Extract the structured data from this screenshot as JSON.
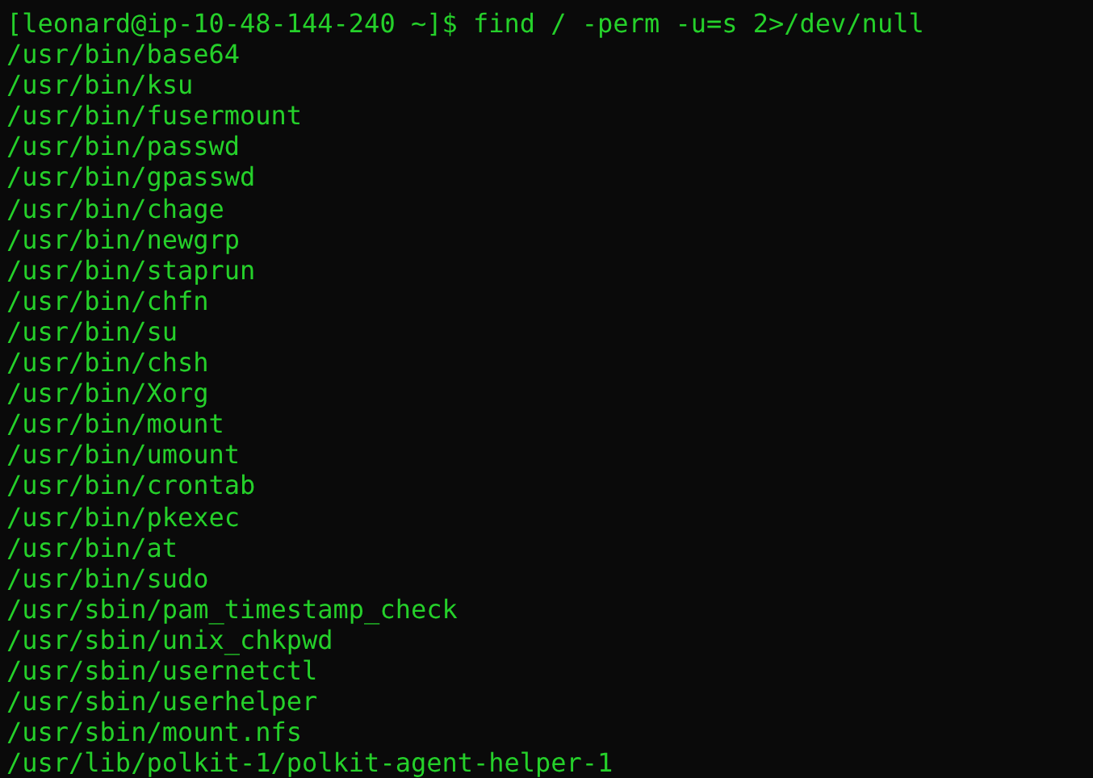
{
  "terminal": {
    "prompt": "[leonard@ip-10-48-144-240 ~]$ find / -perm -u=s 2>/dev/null",
    "output": [
      "/usr/bin/base64",
      "/usr/bin/ksu",
      "/usr/bin/fusermount",
      "/usr/bin/passwd",
      "/usr/bin/gpasswd",
      "/usr/bin/chage",
      "/usr/bin/newgrp",
      "/usr/bin/staprun",
      "/usr/bin/chfn",
      "/usr/bin/su",
      "/usr/bin/chsh",
      "/usr/bin/Xorg",
      "/usr/bin/mount",
      "/usr/bin/umount",
      "/usr/bin/crontab",
      "/usr/bin/pkexec",
      "/usr/bin/at",
      "/usr/bin/sudo",
      "/usr/sbin/pam_timestamp_check",
      "/usr/sbin/unix_chkpwd",
      "/usr/sbin/usernetctl",
      "/usr/sbin/userhelper",
      "/usr/sbin/mount.nfs",
      "/usr/lib/polkit-1/polkit-agent-helper-1"
    ]
  }
}
